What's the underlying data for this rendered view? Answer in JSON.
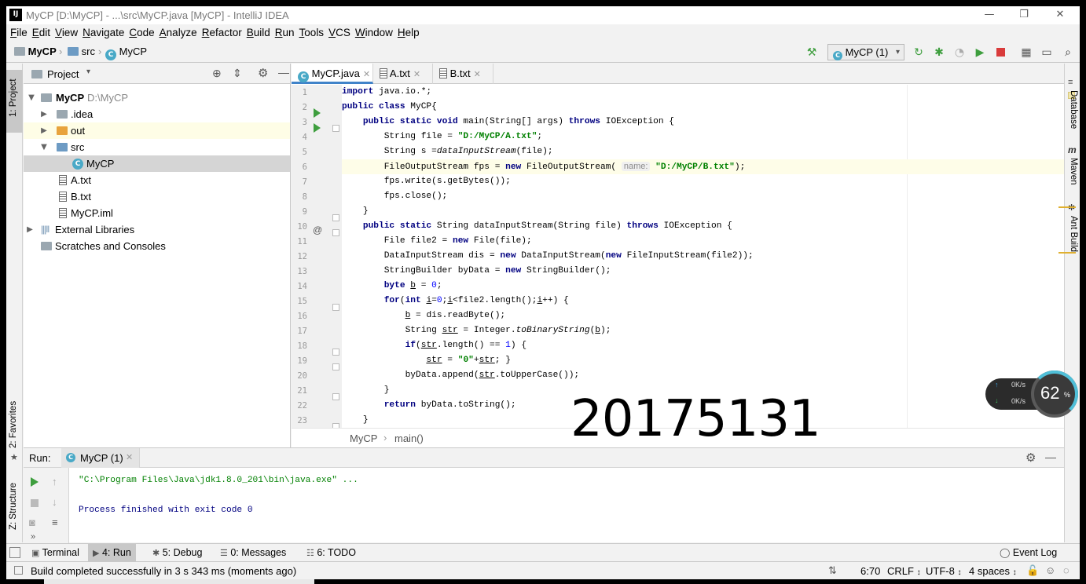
{
  "window": {
    "title": "MyCP [D:\\MyCP] - ...\\src\\MyCP.java [MyCP] - IntelliJ IDEA",
    "app_icon": "IJ",
    "minimize": "—",
    "maximize": "❐",
    "close": "✕"
  },
  "menu": [
    "File",
    "Edit",
    "View",
    "Navigate",
    "Code",
    "Analyze",
    "Refactor",
    "Build",
    "Run",
    "Tools",
    "VCS",
    "Window",
    "Help"
  ],
  "nav": {
    "project": "MyCP",
    "folder": "src",
    "class": "MyCP",
    "run_config": "MyCP (1)"
  },
  "left_stripe": {
    "project_tab": "1: Project",
    "favorites_tab": "2: Favorites",
    "structure_tab": "Z: Structure"
  },
  "project_panel": {
    "title": "Project",
    "tree": [
      {
        "label": "MyCP",
        "suffix": "D:\\MyCP",
        "icon": "module-folder-icon"
      },
      {
        "label": ".idea",
        "icon": "folder-icon"
      },
      {
        "label": "out",
        "icon": "folder-orange-icon"
      },
      {
        "label": "src",
        "icon": "source-folder-icon"
      },
      {
        "label": "MyCP",
        "icon": "class-icon"
      },
      {
        "label": "A.txt",
        "icon": "text-file-icon"
      },
      {
        "label": "B.txt",
        "icon": "text-file-icon"
      },
      {
        "label": "MyCP.iml",
        "icon": "iml-file-icon"
      },
      {
        "label": "External Libraries",
        "icon": "library-icon"
      },
      {
        "label": "Scratches and Consoles",
        "icon": "scratches-icon"
      }
    ]
  },
  "editor": {
    "tabs": [
      {
        "label": "MyCP.java",
        "icon": "class-icon",
        "active": true
      },
      {
        "label": "A.txt",
        "icon": "text-file-icon",
        "active": false
      },
      {
        "label": "B.txt",
        "icon": "text-file-icon",
        "active": false
      }
    ],
    "line_numbers": [
      "1",
      "2",
      "3",
      "4",
      "5",
      "6",
      "7",
      "8",
      "9",
      "10",
      "11",
      "12",
      "13",
      "14",
      "15",
      "16",
      "17",
      "18",
      "19",
      "20",
      "21",
      "22",
      "23"
    ],
    "param_hint": "name:",
    "breadcrumb": {
      "class": "MyCP",
      "method": "main()"
    }
  },
  "right_stripe": {
    "database": "Database",
    "maven": "Maven",
    "ant": "Ant Build"
  },
  "run_panel": {
    "label": "Run:",
    "tab": "MyCP (1)",
    "console": [
      "\"C:\\Program Files\\Java\\jdk1.8.0_201\\bin\\java.exe\" ...",
      "",
      "Process finished with exit code 0"
    ]
  },
  "bottom_tabs": [
    {
      "label": "Terminal",
      "icon": "terminal-icon"
    },
    {
      "label": "4: Run",
      "icon": "run-icon",
      "active": true
    },
    {
      "label": "5: Debug",
      "icon": "debug-icon"
    },
    {
      "label": "0: Messages",
      "icon": "messages-icon"
    },
    {
      "label": "6: TODO",
      "icon": "todo-icon"
    }
  ],
  "event_log": "Event Log",
  "status": {
    "message": "Build completed successfully in 3 s 343 ms (moments ago)",
    "position": "6:70",
    "line_sep": "CRLF",
    "encoding": "UTF-8",
    "indent": "4 spaces"
  },
  "overlay": {
    "number": "20175131",
    "net_up": "0K/s",
    "net_down": "0K/s",
    "percent": "62",
    "percent_sign": "%"
  },
  "colors": {
    "keyword": "#000080",
    "string": "#008000",
    "accent": "#4083c9",
    "run_green": "#3e9e3e"
  }
}
